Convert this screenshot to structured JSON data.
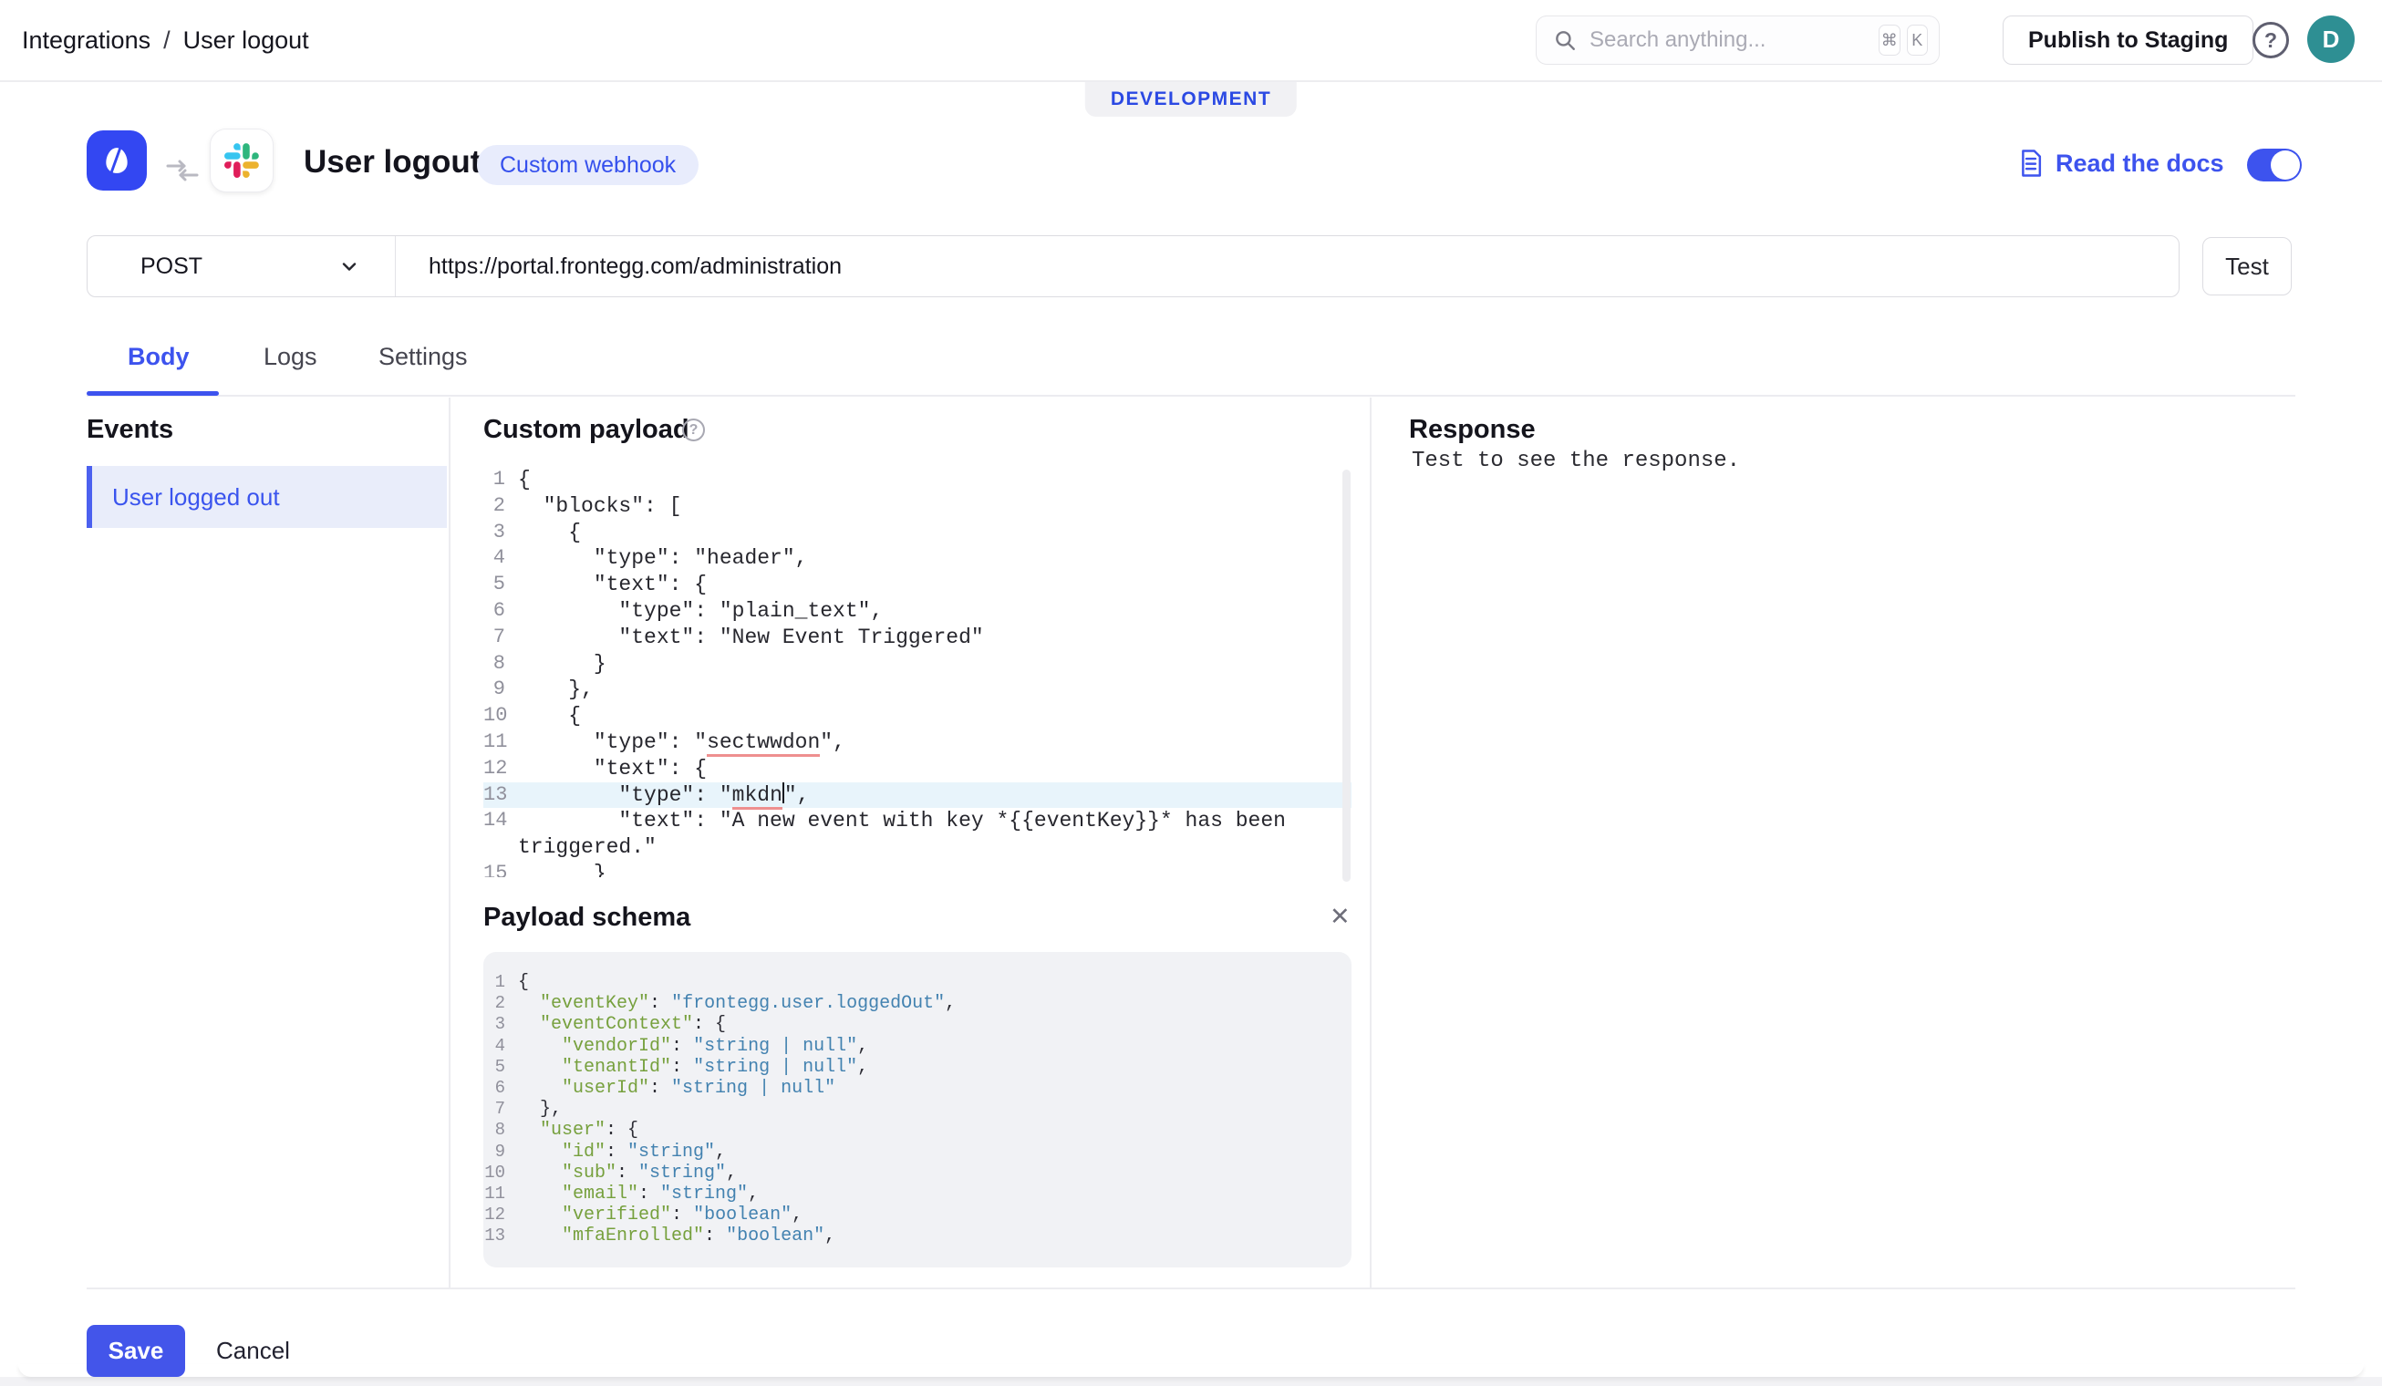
{
  "topbar": {
    "breadcrumb": {
      "items": [
        "Integrations",
        "User logout"
      ],
      "separator": "/"
    },
    "search": {
      "placeholder": "Search anything...",
      "keys": [
        "⌘",
        "K"
      ]
    },
    "publish_label": "Publish to Staging",
    "avatar_initial": "D"
  },
  "environment_badge": "DEVELOPMENT",
  "header": {
    "title": "User logout",
    "type_badge": "Custom webhook",
    "docs_link": "Read the docs",
    "toggle_on": true
  },
  "request": {
    "method": "POST",
    "url": "https://portal.frontegg.com/administration",
    "test_label": "Test"
  },
  "tabs": {
    "body": "Body",
    "logs": "Logs",
    "settings": "Settings",
    "active": "Body"
  },
  "events": {
    "heading": "Events",
    "selected_item": "User logged out"
  },
  "payload": {
    "heading": "Custom payload",
    "lines": [
      "{",
      "  \"blocks\": [",
      "    {",
      "      \"type\": \"header\",",
      "      \"text\": {",
      "        \"type\": \"plain_text\",",
      "        \"text\": \"New Event Triggered\"",
      "      }",
      "    },",
      "    {",
      "      \"type\": \"sectwwdon\",",
      "      \"text\": {",
      "        \"type\": \"mkdn\",",
      "        \"text\": \"A new event with key *{{eventKey}}* has been triggered.\"",
      "      }"
    ],
    "annotations": [
      {
        "line": 11,
        "word": "sectwwdon"
      },
      {
        "line": 13,
        "word": "mkdn",
        "caret": true,
        "highlight": true
      }
    ]
  },
  "schema": {
    "heading": "Payload schema",
    "close_icon": "✕",
    "lines": [
      "{",
      "  \"eventKey\": \"frontegg.user.loggedOut\",",
      "  \"eventContext\": {",
      "    \"vendorId\": \"string | null\",",
      "    \"tenantId\": \"string | null\",",
      "    \"userId\": \"string | null\"",
      "  },",
      "  \"user\": {",
      "    \"id\": \"string\",",
      "    \"sub\": \"string\",",
      "    \"email\": \"string\",",
      "    \"verified\": \"boolean\",",
      "    \"mfaEnrolled\": \"boolean\","
    ]
  },
  "response": {
    "heading": "Response",
    "placeholder_text": "Test to see the response."
  },
  "footer": {
    "save_label": "Save",
    "cancel_label": "Cancel"
  },
  "colors": {
    "accent": "#3d53ee",
    "dev_badge_text": "#2b49e3",
    "selected_event_bg": "#e9edfa",
    "highlight_row": "#e8f4fb",
    "misspell_underline": "#ee8f8f",
    "schema_key": "#76a03d",
    "schema_value": "#4382b0",
    "avatar_bg": "#2e8f93"
  }
}
